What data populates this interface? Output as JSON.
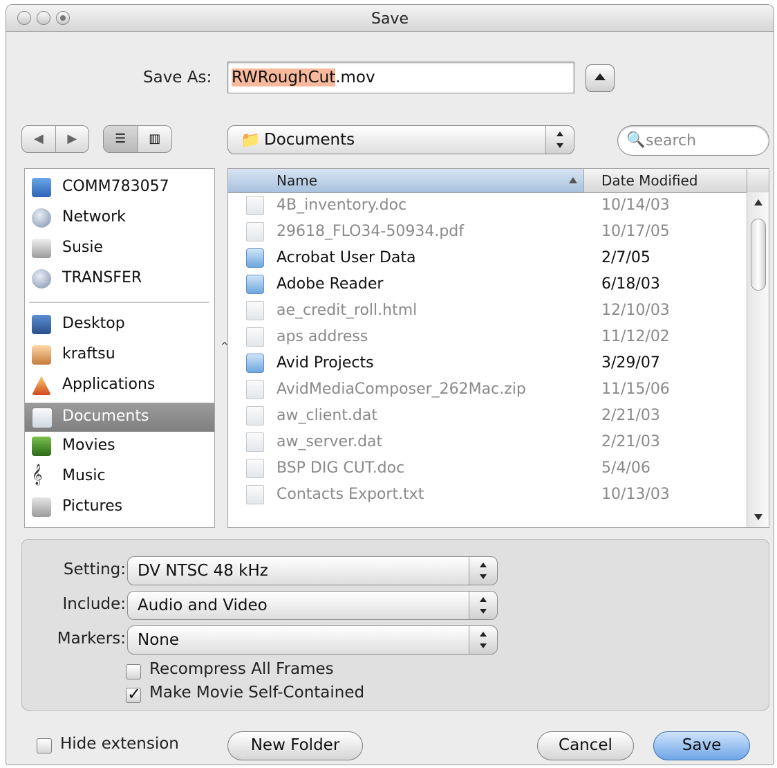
{
  "window": {
    "title": "Save"
  },
  "save_as": {
    "label": "Save As:",
    "filename_selected": "RWRoughCut",
    "filename_ext": ".mov"
  },
  "nav": {
    "location": "Documents",
    "search_placeholder": "search"
  },
  "sidebar": {
    "devices": [
      {
        "label": "COMM783057",
        "icon": "computer-icon"
      },
      {
        "label": "Network",
        "icon": "globe-icon"
      },
      {
        "label": "Susie",
        "icon": "disk-icon"
      },
      {
        "label": "TRANSFER",
        "icon": "network-disk-icon"
      }
    ],
    "places": [
      {
        "label": "Desktop",
        "icon": "desktop-icon"
      },
      {
        "label": "kraftsu",
        "icon": "home-icon"
      },
      {
        "label": "Applications",
        "icon": "applications-icon"
      },
      {
        "label": "Documents",
        "icon": "documents-icon",
        "selected": true
      },
      {
        "label": "Movies",
        "icon": "movies-icon"
      },
      {
        "label": "Music",
        "icon": "music-icon"
      },
      {
        "label": "Pictures",
        "icon": "pictures-icon"
      }
    ]
  },
  "file_list": {
    "columns": [
      "Name",
      "Date Modified"
    ],
    "rows": [
      {
        "name": "4B_inventory.doc",
        "date": "10/14/03",
        "kind": "doc",
        "enabled": false
      },
      {
        "name": "29618_FLO34-50934.pdf",
        "date": "10/17/05",
        "kind": "doc",
        "enabled": false
      },
      {
        "name": "Acrobat User Data",
        "date": "2/7/05",
        "kind": "folder",
        "enabled": true
      },
      {
        "name": "Adobe Reader",
        "date": "6/18/03",
        "kind": "folder",
        "enabled": true
      },
      {
        "name": "ae_credit_roll.html",
        "date": "12/10/03",
        "kind": "doc",
        "enabled": false
      },
      {
        "name": "aps address",
        "date": "11/12/02",
        "kind": "doc",
        "enabled": false
      },
      {
        "name": "Avid Projects",
        "date": "3/29/07",
        "kind": "folder",
        "enabled": true
      },
      {
        "name": "AvidMediaComposer_262Mac.zip",
        "date": "11/15/06",
        "kind": "doc",
        "enabled": false
      },
      {
        "name": "aw_client.dat",
        "date": "2/21/03",
        "kind": "doc",
        "enabled": false
      },
      {
        "name": "aw_server.dat",
        "date": "2/21/03",
        "kind": "doc",
        "enabled": false
      },
      {
        "name": "BSP DIG CUT.doc",
        "date": "5/4/06",
        "kind": "doc",
        "enabled": false
      },
      {
        "name": "Contacts Export.txt",
        "date": "10/13/03",
        "kind": "doc",
        "enabled": false
      }
    ]
  },
  "options": {
    "setting": {
      "label": "Setting:",
      "value": "DV NTSC 48 kHz"
    },
    "include": {
      "label": "Include:",
      "value": "Audio and Video"
    },
    "markers": {
      "label": "Markers:",
      "value": "None"
    },
    "recompress": {
      "label": "Recompress All Frames",
      "checked": false
    },
    "self_contained": {
      "label": "Make Movie Self-Contained",
      "checked": true
    }
  },
  "footer": {
    "hide_extension": {
      "label": "Hide extension",
      "checked": false
    },
    "new_folder": "New Folder",
    "cancel": "Cancel",
    "save": "Save"
  }
}
